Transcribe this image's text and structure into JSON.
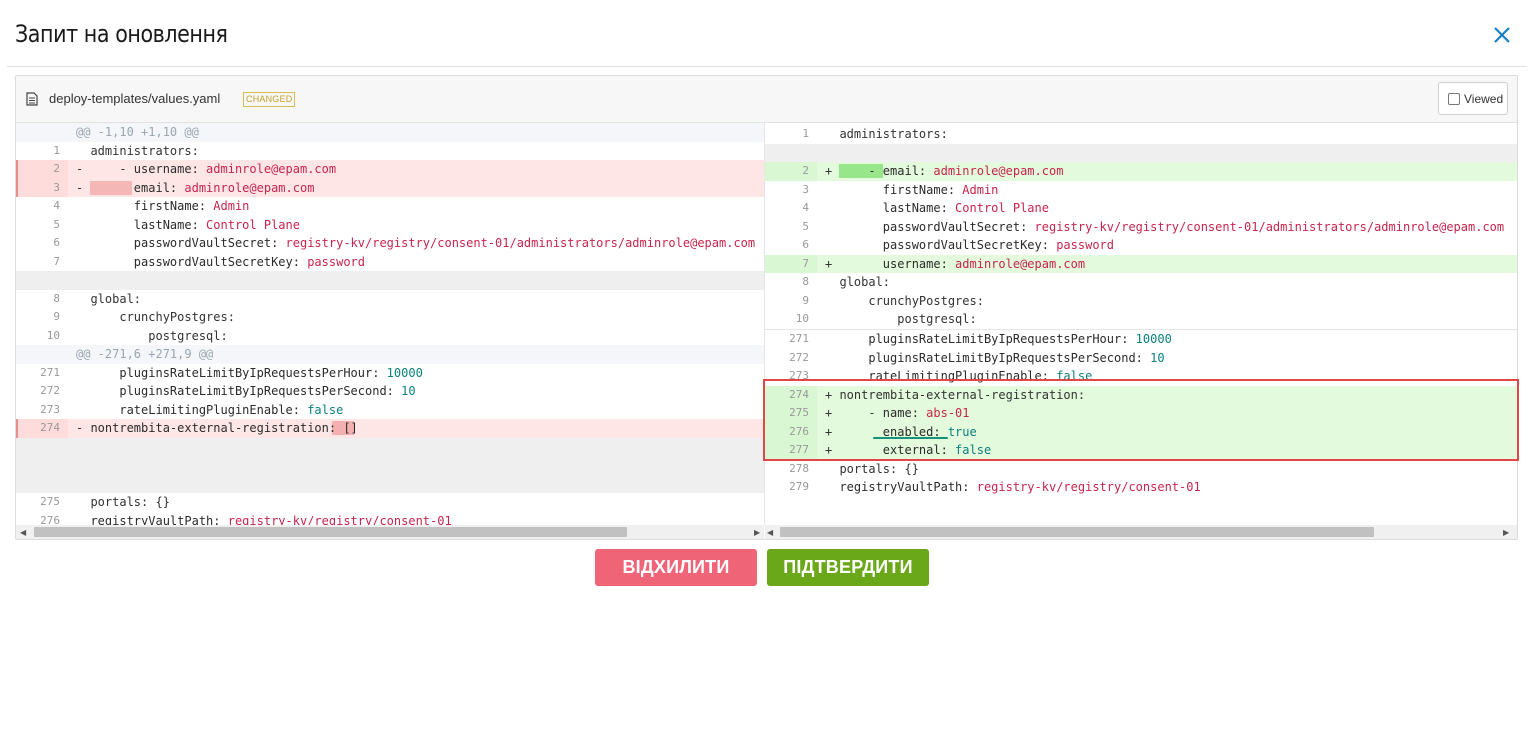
{
  "dialog": {
    "title": "Запит на оновлення"
  },
  "file": {
    "name": "deploy-templates/values.yaml",
    "badge": "CHANGED",
    "viewed_label": "Viewed"
  },
  "left_hunks": [
    "@@ -1,10 +1,10 @@",
    "@@ -271,6 +271,9 @@"
  ],
  "left_lines": [
    {
      "num": "1",
      "text": "  administrators:"
    },
    {
      "num": "2",
      "pre": "-     - ",
      "key": "username:",
      "val": " adminrole@epam.com"
    },
    {
      "num": "3",
      "pre": "-       ",
      "key": "email:",
      "val": " adminrole@epam.com"
    },
    {
      "num": "4",
      "pre": "        ",
      "key": "firstName:",
      "val": " Admin"
    },
    {
      "num": "5",
      "pre": "        ",
      "key": "lastName:",
      "val": " Control Plane"
    },
    {
      "num": "6",
      "pre": "        ",
      "key": "passwordVaultSecret:",
      "val": " registry-kv/registry/consent-01/administrators/adminrole@epam.com"
    },
    {
      "num": "7",
      "pre": "        ",
      "key": "passwordVaultSecretKey:",
      "val": " password"
    },
    {
      "num": "8",
      "text": "  global:"
    },
    {
      "num": "9",
      "text": "      crunchyPostgres:"
    },
    {
      "num": "10",
      "text": "          postgresql:"
    },
    {
      "num": "271",
      "pre": "      ",
      "key": "pluginsRateLimitByIpRequestsPerHour:",
      "val": " 10000"
    },
    {
      "num": "272",
      "pre": "      ",
      "key": "pluginsRateLimitByIpRequestsPerSecond:",
      "val": " 10"
    },
    {
      "num": "273",
      "pre": "      ",
      "key": "rateLimitingPluginEnable:",
      "val": " false"
    },
    {
      "num": "274",
      "pre": "- ",
      "key": "nontrembita-external-registration:",
      "val": " []"
    },
    {
      "num": "275",
      "text": "  portals: {}"
    },
    {
      "num": "276",
      "pre": "  ",
      "key": "registryVaultPath:",
      "val": " registry-kv/registry/consent-01"
    }
  ],
  "right_lines": [
    {
      "num": "1",
      "text": "  administrators:"
    },
    {
      "num": "2",
      "pre": "+     - ",
      "key": "email:",
      "val": " adminrole@epam.com"
    },
    {
      "num": "3",
      "pre": "        ",
      "key": "firstName:",
      "val": " Admin"
    },
    {
      "num": "4",
      "pre": "        ",
      "key": "lastName:",
      "val": " Control Plane"
    },
    {
      "num": "5",
      "pre": "        ",
      "key": "passwordVaultSecret:",
      "val": " registry-kv/registry/consent-01/administrators/adminrole@epam.com"
    },
    {
      "num": "6",
      "pre": "        ",
      "key": "passwordVaultSecretKey:",
      "val": " password"
    },
    {
      "num": "7",
      "pre": "+       ",
      "key": "username:",
      "val": " adminrole@epam.com"
    },
    {
      "num": "8",
      "text": "  global:"
    },
    {
      "num": "9",
      "text": "      crunchyPostgres:"
    },
    {
      "num": "10",
      "text": "          postgresql:"
    },
    {
      "num": "271",
      "pre": "      ",
      "key": "pluginsRateLimitByIpRequestsPerHour:",
      "val": " 10000"
    },
    {
      "num": "272",
      "pre": "      ",
      "key": "pluginsRateLimitByIpRequestsPerSecond:",
      "val": " 10"
    },
    {
      "num": "273",
      "pre": "      ",
      "key": "rateLimitingPluginEnable:",
      "val": " false"
    },
    {
      "num": "274",
      "text": "+ nontrembita-external-registration:"
    },
    {
      "num": "275",
      "pre": "+     - ",
      "key": "name:",
      "val": " abs-01"
    },
    {
      "num": "276",
      "pre": "+       ",
      "key": "enabled:",
      "val": " true"
    },
    {
      "num": "277",
      "pre": "+       ",
      "key": "external:",
      "val": " false"
    },
    {
      "num": "278",
      "text": "  portals: {}"
    },
    {
      "num": "279",
      "pre": "  ",
      "key": "registryVaultPath:",
      "val": " registry-kv/registry/consent-01"
    }
  ],
  "actions": {
    "reject_label": "ВІДХИЛИТИ",
    "confirm_label": "ПІДТВЕРДИТИ"
  },
  "colors": {
    "reject": "#f06477",
    "confirm": "#6aa81a",
    "highlight_box": "#e04848",
    "close_icon": "#1a7fc1"
  }
}
